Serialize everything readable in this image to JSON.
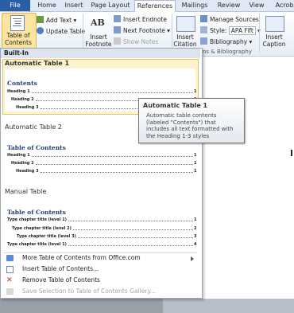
{
  "tabs": [
    {
      "label": "File",
      "active": false
    },
    {
      "label": "Home",
      "active": false
    },
    {
      "label": "Insert",
      "active": false
    },
    {
      "label": "Page Layout",
      "active": false
    },
    {
      "label": "References",
      "active": true
    },
    {
      "label": "Mailings",
      "active": false
    },
    {
      "label": "Review",
      "active": false
    },
    {
      "label": "View",
      "active": false
    },
    {
      "label": "Acrob",
      "active": false
    }
  ],
  "ribbon": {
    "toc_button": "Table of Contents",
    "add_text": "Add Text",
    "update_table": "Update Table",
    "insert_footnote": "Insert Footnote",
    "insert_endnote": "Insert Endnote",
    "next_footnote": "Next Footnote",
    "show_notes": "Show Notes",
    "insert_citation": "Insert Citation",
    "manage_sources": "Manage Sources",
    "style_label": "Style:",
    "style_value": "APA Fift",
    "bibliography": "Bibliography",
    "group_citations": "ns & Bibliography",
    "insert_caption": "Insert Caption",
    "footnote_icon_text": "AB"
  },
  "gallery": {
    "section_header": "Built-In",
    "items": [
      {
        "title": "Automatic Table 1",
        "heading": "Contents",
        "lines": [
          {
            "text": "Heading 1",
            "page": "1",
            "level": 1
          },
          {
            "text": "Heading 2",
            "page": "1",
            "level": 2
          },
          {
            "text": "Heading 3",
            "page": "1",
            "level": 3
          }
        ]
      },
      {
        "title": "Automatic Table 2",
        "heading": "Table of Contents",
        "lines": [
          {
            "text": "Heading 1",
            "page": "1",
            "level": 1
          },
          {
            "text": "Heading 2",
            "page": "1",
            "level": 2
          },
          {
            "text": "Heading 3",
            "page": "1",
            "level": 3
          }
        ]
      },
      {
        "title": "Manual Table",
        "heading": "Table of Contents",
        "lines": [
          {
            "text": "Type chapter title (level 1)",
            "page": "1",
            "level": 1
          },
          {
            "text": "Type chapter title (level 2)",
            "page": "2",
            "level": 2
          },
          {
            "text": "Type chapter title (level 3)",
            "page": "3",
            "level": 3
          },
          {
            "text": "Type chapter title (level 1)",
            "page": "4",
            "level": 1
          }
        ]
      }
    ],
    "menu": [
      {
        "label": "More Table of Contents from Office.com",
        "submenu": true,
        "disabled": false
      },
      {
        "label": "Insert Table of Contents...",
        "submenu": false,
        "disabled": false
      },
      {
        "label": "Remove Table of Contents",
        "submenu": false,
        "disabled": false
      },
      {
        "label": "Save Selection to Table of Contents Gallery...",
        "submenu": false,
        "disabled": true
      }
    ]
  },
  "tooltip": {
    "title": "Automatic Table 1",
    "description": "Automatic table contents (labeled \"Contents\") that includes all text formatted with the Heading 1-3 styles"
  },
  "colors": {
    "file_tab": "#2a5fa8",
    "highlight": "#fdf4cf",
    "toc_heading": "#1f3f7a"
  }
}
